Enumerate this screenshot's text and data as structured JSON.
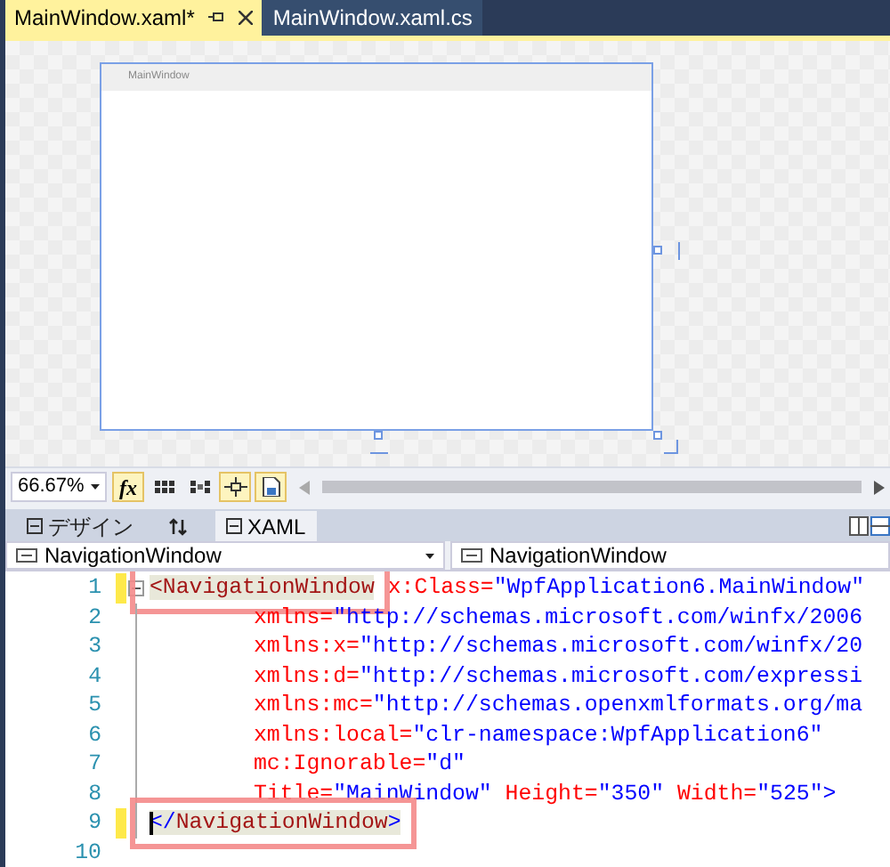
{
  "tabs": [
    {
      "label": "MainWindow.xaml*",
      "selected": true
    },
    {
      "label": "MainWindow.xaml.cs",
      "selected": false
    }
  ],
  "designer": {
    "window_title": "MainWindow"
  },
  "toolbar": {
    "zoom": "66.67%",
    "buttons": [
      {
        "kind": "fx",
        "label": "fx",
        "on": true
      },
      {
        "kind": "grid",
        "on": false
      },
      {
        "kind": "snap-grid",
        "on": false
      },
      {
        "kind": "snap-lines",
        "on": true
      },
      {
        "kind": "project-code",
        "on": true
      }
    ]
  },
  "view_tabs": [
    {
      "label": "デザイン",
      "selected": false
    },
    {
      "label": "XAML",
      "selected": true
    }
  ],
  "selectors": [
    "NavigationWindow",
    "NavigationWindow"
  ],
  "code_lines": [
    {
      "number": "1",
      "changed": true,
      "indent": false,
      "cursor": false,
      "tokens": [
        {
          "kind": "tag",
          "text": "<NavigationWindow",
          "highlighted": true
        },
        {
          "kind": "attr",
          "text": " x:Class=",
          "highlighted": false
        },
        {
          "kind": "value",
          "text": "\"WpfApplication6.MainWindow\"",
          "highlighted": false
        }
      ]
    },
    {
      "number": "2",
      "changed": false,
      "indent": true,
      "cursor": false,
      "tokens": [
        {
          "kind": "attr",
          "text": "xmlns=",
          "highlighted": false
        },
        {
          "kind": "value",
          "text": "\"http://schemas.microsoft.com/winfx/2006",
          "highlighted": false
        }
      ]
    },
    {
      "number": "3",
      "changed": false,
      "indent": true,
      "cursor": false,
      "tokens": [
        {
          "kind": "attr",
          "text": "xmlns:x=",
          "highlighted": false
        },
        {
          "kind": "value",
          "text": "\"http://schemas.microsoft.com/winfx/20",
          "highlighted": false
        }
      ]
    },
    {
      "number": "4",
      "changed": false,
      "indent": true,
      "cursor": false,
      "tokens": [
        {
          "kind": "attr",
          "text": "xmlns:d=",
          "highlighted": false
        },
        {
          "kind": "value",
          "text": "\"http://schemas.microsoft.com/expressi",
          "highlighted": false
        }
      ]
    },
    {
      "number": "5",
      "changed": false,
      "indent": true,
      "cursor": false,
      "tokens": [
        {
          "kind": "attr",
          "text": "xmlns:mc=",
          "highlighted": false
        },
        {
          "kind": "value",
          "text": "\"http://schemas.openxmlformats.org/ma",
          "highlighted": false
        }
      ]
    },
    {
      "number": "6",
      "changed": false,
      "indent": true,
      "cursor": false,
      "tokens": [
        {
          "kind": "attr",
          "text": "xmlns:local=",
          "highlighted": false
        },
        {
          "kind": "value",
          "text": "\"clr-namespace:WpfApplication6\"",
          "highlighted": false
        }
      ]
    },
    {
      "number": "7",
      "changed": false,
      "indent": true,
      "cursor": false,
      "tokens": [
        {
          "kind": "attr",
          "text": "mc:Ignorable=",
          "highlighted": false
        },
        {
          "kind": "value",
          "text": "\"d\"",
          "highlighted": false
        }
      ]
    },
    {
      "number": "8",
      "changed": false,
      "indent": true,
      "cursor": false,
      "tokens": [
        {
          "kind": "attr",
          "text": "Title=",
          "highlighted": false
        },
        {
          "kind": "value",
          "text": "\"MainWindow\"",
          "highlighted": false
        },
        {
          "kind": "attr",
          "text": " Height=",
          "highlighted": false
        },
        {
          "kind": "value",
          "text": "\"350\"",
          "highlighted": false
        },
        {
          "kind": "attr",
          "text": " Width=",
          "highlighted": false
        },
        {
          "kind": "value",
          "text": "\"525\"",
          "highlighted": false
        },
        {
          "kind": "punct",
          "text": ">",
          "highlighted": false
        }
      ]
    },
    {
      "number": "9",
      "changed": true,
      "indent": false,
      "cursor": true,
      "tokens": [
        {
          "kind": "punct",
          "text": "</",
          "highlighted": true
        },
        {
          "kind": "tag",
          "text": "NavigationWindow",
          "highlighted": true
        },
        {
          "kind": "punct",
          "text": ">",
          "highlighted": true
        }
      ]
    },
    {
      "number": "10",
      "changed": false,
      "cursor": false
    }
  ]
}
